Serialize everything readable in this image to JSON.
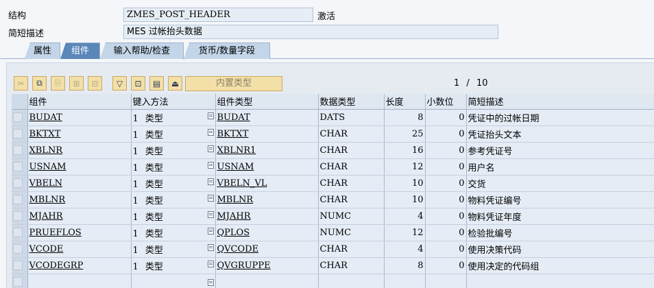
{
  "header": {
    "structure_label": "结构",
    "structure_value": "ZMES_POST_HEADER",
    "status": "激活",
    "desc_label": "简短描述",
    "desc_value": "MES 过帐抬头数据"
  },
  "tabs": [
    "属性",
    "组件",
    "输入帮助/检查",
    "货币/数量字段"
  ],
  "active_tab": "组件",
  "toolbar": {
    "icons": [
      "cut-icon",
      "copy-icon",
      "paste-icon",
      "insert-row-icon",
      "delete-row-icon",
      "filter-icon",
      "sort-icon",
      "details-icon",
      "collapse-icon"
    ],
    "builtin_type_label": "内置类型",
    "page_current": "1",
    "page_sep": "/",
    "page_total": "10"
  },
  "table": {
    "columns": [
      "组件",
      "键入方法",
      "组件类型",
      "数据类型",
      "长度",
      "小数位",
      "简短描述"
    ],
    "rows": [
      {
        "component": "BUDAT",
        "method": "1",
        "method_text": "类型",
        "type": "BUDAT",
        "datatype": "DATS",
        "length": "8",
        "decimals": "0",
        "desc": "凭证中的过帐日期"
      },
      {
        "component": "BKTXT",
        "method": "1",
        "method_text": "类型",
        "type": "BKTXT",
        "datatype": "CHAR",
        "length": "25",
        "decimals": "0",
        "desc": "凭证抬头文本"
      },
      {
        "component": "XBLNR",
        "method": "1",
        "method_text": "类型",
        "type": "XBLNR1",
        "datatype": "CHAR",
        "length": "16",
        "decimals": "0",
        "desc": "参考凭证号"
      },
      {
        "component": "USNAM",
        "method": "1",
        "method_text": "类型",
        "type": "USNAM",
        "datatype": "CHAR",
        "length": "12",
        "decimals": "0",
        "desc": "用户名"
      },
      {
        "component": "VBELN",
        "method": "1",
        "method_text": "类型",
        "type": "VBELN_VL",
        "datatype": "CHAR",
        "length": "10",
        "decimals": "0",
        "desc": "交货"
      },
      {
        "component": "MBLNR",
        "method": "1",
        "method_text": "类型",
        "type": "MBLNR",
        "datatype": "CHAR",
        "length": "10",
        "decimals": "0",
        "desc": "物料凭证编号"
      },
      {
        "component": "MJAHR",
        "method": "1",
        "method_text": "类型",
        "type": "MJAHR",
        "datatype": "NUMC",
        "length": "4",
        "decimals": "0",
        "desc": "物料凭证年度"
      },
      {
        "component": "PRUEFLOS",
        "method": "1",
        "method_text": "类型",
        "type": "QPLOS",
        "datatype": "NUMC",
        "length": "12",
        "decimals": "0",
        "desc": "检验批编号"
      },
      {
        "component": "VCODE",
        "method": "1",
        "method_text": "类型",
        "type": "QVCODE",
        "datatype": "CHAR",
        "length": "4",
        "decimals": "0",
        "desc": "使用决策代码"
      },
      {
        "component": "VCODEGRP",
        "method": "1",
        "method_text": "类型",
        "type": "QVGRUPPE",
        "datatype": "CHAR",
        "length": "8",
        "decimals": "0",
        "desc": "使用决定的代码组"
      }
    ]
  }
}
